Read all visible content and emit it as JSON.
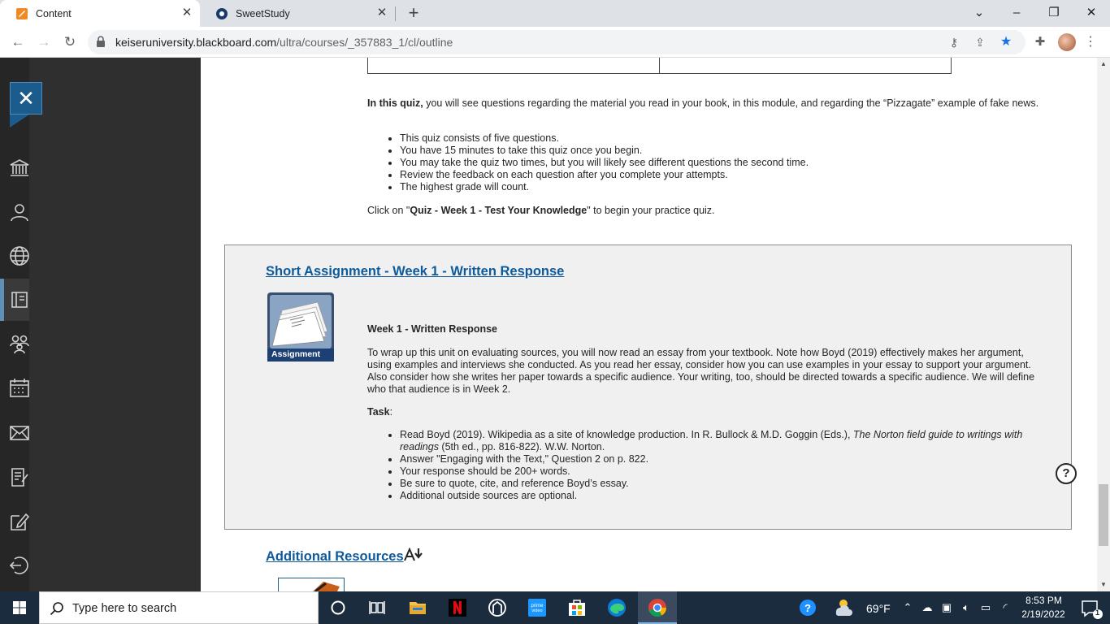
{
  "browser": {
    "tabs": [
      {
        "title": "Content",
        "active": true
      },
      {
        "title": "SweetStudy",
        "active": false
      }
    ],
    "url_host": "keiseruniversity.blackboard.com",
    "url_path": "/ultra/courses/_357883_1/cl/outline"
  },
  "quiz": {
    "intro_bold": "In this quiz,",
    "intro_rest": " you will see questions regarding the material you read in your book, in this module, and regarding the “Pizzagate” example of fake news.",
    "bullets": [
      "This quiz consists of five questions.",
      "You have 15 minutes to take this quiz once you begin.",
      "You may take the quiz two times, but you will likely see different questions the second time.",
      "Review the feedback on each question after you complete your attempts.",
      "The highest grade will count."
    ],
    "click_pre": "Click on \"",
    "click_bold": "Quiz - Week 1 - Test Your Knowledge",
    "click_post": "\" to begin your practice quiz."
  },
  "assignment": {
    "link": "Short Assignment - Week 1 - Written Response",
    "badge": "Assignment",
    "title": "Week 1 - Written Response",
    "paragraph": "To wrap up this unit on evaluating sources, you will now read an essay from your textbook. Note how Boyd (2019) effectively makes her argument, using examples and interviews she conducted. As you read her essay, consider how you can use examples in your essay to support your argument. Also consider how she writes her paper towards a specific audience. Your writing, too, should be directed towards a specific audience. We will define who that audience is in Week 2.",
    "task_label": "Task",
    "task_colon": ":",
    "task_b1_pre": "Read Boyd (2019). Wikipedia as a site of knowledge production. In R. Bullock & M.D. Goggin (Eds.), ",
    "task_b1_italic": "The Norton field guide to writings with readings",
    "task_b1_post": " (5th ed., pp. 816-822). W.W. Norton.",
    "task_bullets": [
      "Answer \"Engaging with the Text,\" Question 2 on p. 822.",
      "Your response should be 200+ words.",
      "Be sure to quote, cite, and reference Boyd’s essay.",
      "Additional outside sources are optional."
    ]
  },
  "additional": {
    "link": "Additional Resources"
  },
  "taskbar": {
    "search_placeholder": "Type here to search",
    "weather": "69°F",
    "time": "8:53 PM",
    "date": "2/19/2022",
    "notif_count": "1"
  },
  "colors": {
    "link": "#0e5a9c",
    "bb_dark": "#2f2f2f",
    "bb_accent": "#1c5c8c",
    "taskbar": "#1c2c3f"
  }
}
